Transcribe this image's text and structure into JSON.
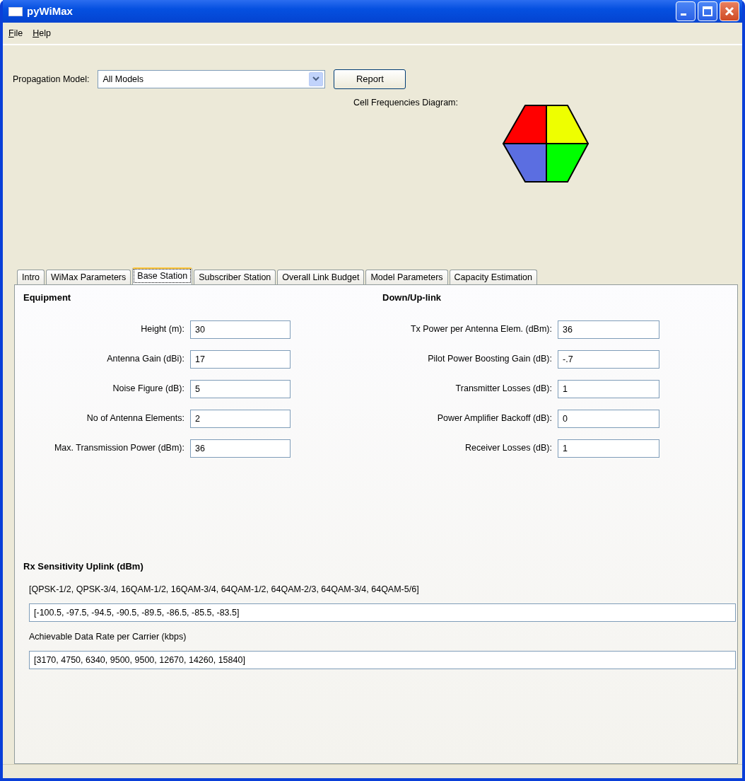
{
  "window": {
    "title": "pyWiMax"
  },
  "menu": [
    {
      "label": "File"
    },
    {
      "label": "Help"
    }
  ],
  "propagation_model": {
    "label": "Propagation Model:",
    "value": "All Models"
  },
  "report_button": "Report",
  "diagram": {
    "label": "Cell Frequencies Diagram:",
    "cells": [
      {
        "color": "#ff0000"
      },
      {
        "color": "#eeff00"
      },
      {
        "color": "#5b6ee1"
      },
      {
        "color": "#00ff00"
      }
    ]
  },
  "tabs": [
    {
      "label": "Intro",
      "selected": false
    },
    {
      "label": "WiMax Parameters",
      "selected": false
    },
    {
      "label": "Base Station",
      "selected": true
    },
    {
      "label": "Subscriber Station",
      "selected": false
    },
    {
      "label": "Overall Link Budget",
      "selected": false
    },
    {
      "label": "Model Parameters",
      "selected": false
    },
    {
      "label": "Capacity Estimation",
      "selected": false
    }
  ],
  "equipment": {
    "title": "Equipment",
    "fields": [
      {
        "label": "Height (m):",
        "value": "30"
      },
      {
        "label": "Antenna Gain (dBi):",
        "value": "17"
      },
      {
        "label": "Noise Figure (dB):",
        "value": "5"
      },
      {
        "label": "No of Antenna Elements:",
        "value": "2"
      },
      {
        "label": "Max. Transmission Power (dBm):",
        "value": "36"
      }
    ]
  },
  "down_up_link": {
    "title": "Down/Up-link",
    "fields": [
      {
        "label": "Tx Power per Antenna Elem. (dBm):",
        "value": "36"
      },
      {
        "label": "Pilot Power Boosting Gain (dB):",
        "value": "-.7"
      },
      {
        "label": "Transmitter Losses (dB):",
        "value": "1"
      },
      {
        "label": "Power Amplifier Backoff (dB):",
        "value": "0"
      },
      {
        "label": "Receiver Losses (dB):",
        "value": "1"
      }
    ]
  },
  "rx_sensitivity": {
    "title": "Rx Sensitivity Uplink (dBm)",
    "modulations": "[QPSK-1/2, QPSK-3/4, 16QAM-1/2, 16QAM-3/4, 64QAM-1/2, 64QAM-2/3, 64QAM-3/4, 64QAM-5/6]",
    "sensitivity_value": "[-100.5, -97.5, -94.5, -90.5, -89.5, -86.5, -85.5, -83.5]",
    "data_rate_label": "Achievable Data Rate per Carrier (kbps)",
    "data_rate_value": "[3170, 4750, 6340, 9500, 9500, 12670, 14260, 15840]"
  }
}
